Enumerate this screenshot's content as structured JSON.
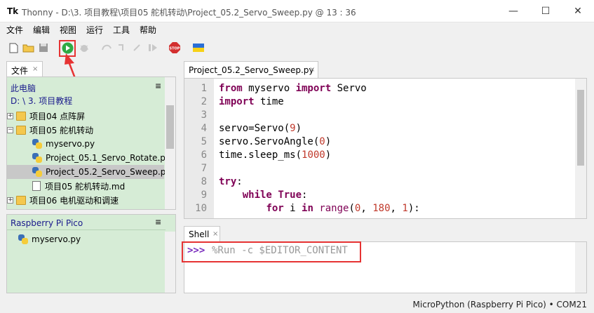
{
  "window": {
    "app_logo": "Tk",
    "title": "Thonny  -  D:\\3. 项目教程\\项目05 舵机转动\\Project_05.2_Servo_Sweep.py  @  13 : 36",
    "minimize": "—",
    "maximize": "☐",
    "close": "✕"
  },
  "menu": [
    "文件",
    "编辑",
    "视图",
    "运行",
    "工具",
    "帮助"
  ],
  "files_panel": {
    "tab_label": "文件",
    "tab_close": "×",
    "computer_label": "此电脑",
    "path_label": "D: \\ 3. 项目教程",
    "menu_glyph": "≡",
    "tree": [
      {
        "expander": "+",
        "icon": "folder-icon",
        "label": "项目04 点阵屏"
      },
      {
        "expander": "−",
        "icon": "folder-icon",
        "label": "项目05 舵机转动"
      },
      {
        "icon": "python-file-icon",
        "label": "myservo.py"
      },
      {
        "icon": "python-file-icon",
        "label": "Project_05.1_Servo_Rotate.py"
      },
      {
        "icon": "python-file-icon",
        "label": "Project_05.2_Servo_Sweep.py",
        "selected": true
      },
      {
        "icon": "text-file-icon",
        "label": "项目05 舵机转动.md"
      },
      {
        "expander": "+",
        "icon": "folder-icon",
        "label": "项目06 电机驱动和调速"
      }
    ]
  },
  "pico_panel": {
    "title": "Raspberry Pi Pico",
    "menu_glyph": "≡",
    "files": [
      {
        "icon": "python-file-icon",
        "label": "myservo.py"
      }
    ]
  },
  "editor": {
    "tab_label": "Project_05.2_Servo_Sweep.py",
    "tab_close": "×",
    "line_numbers": [
      "1",
      "2",
      "3",
      "4",
      "5",
      "6",
      "7",
      "8",
      "9",
      "10"
    ]
  },
  "shell": {
    "tab_label": "Shell",
    "tab_close": "×",
    "prompt": ">>>",
    "command": "%Run -c $EDITOR_CONTENT"
  },
  "status": {
    "text": "MicroPython (Raspberry Pi Pico)  •  COM21"
  },
  "colors": {
    "highlight": "#e63333",
    "panel_green": "#d6ecd6",
    "run_green": "#2eaa44",
    "keyword": "#7f0055"
  }
}
